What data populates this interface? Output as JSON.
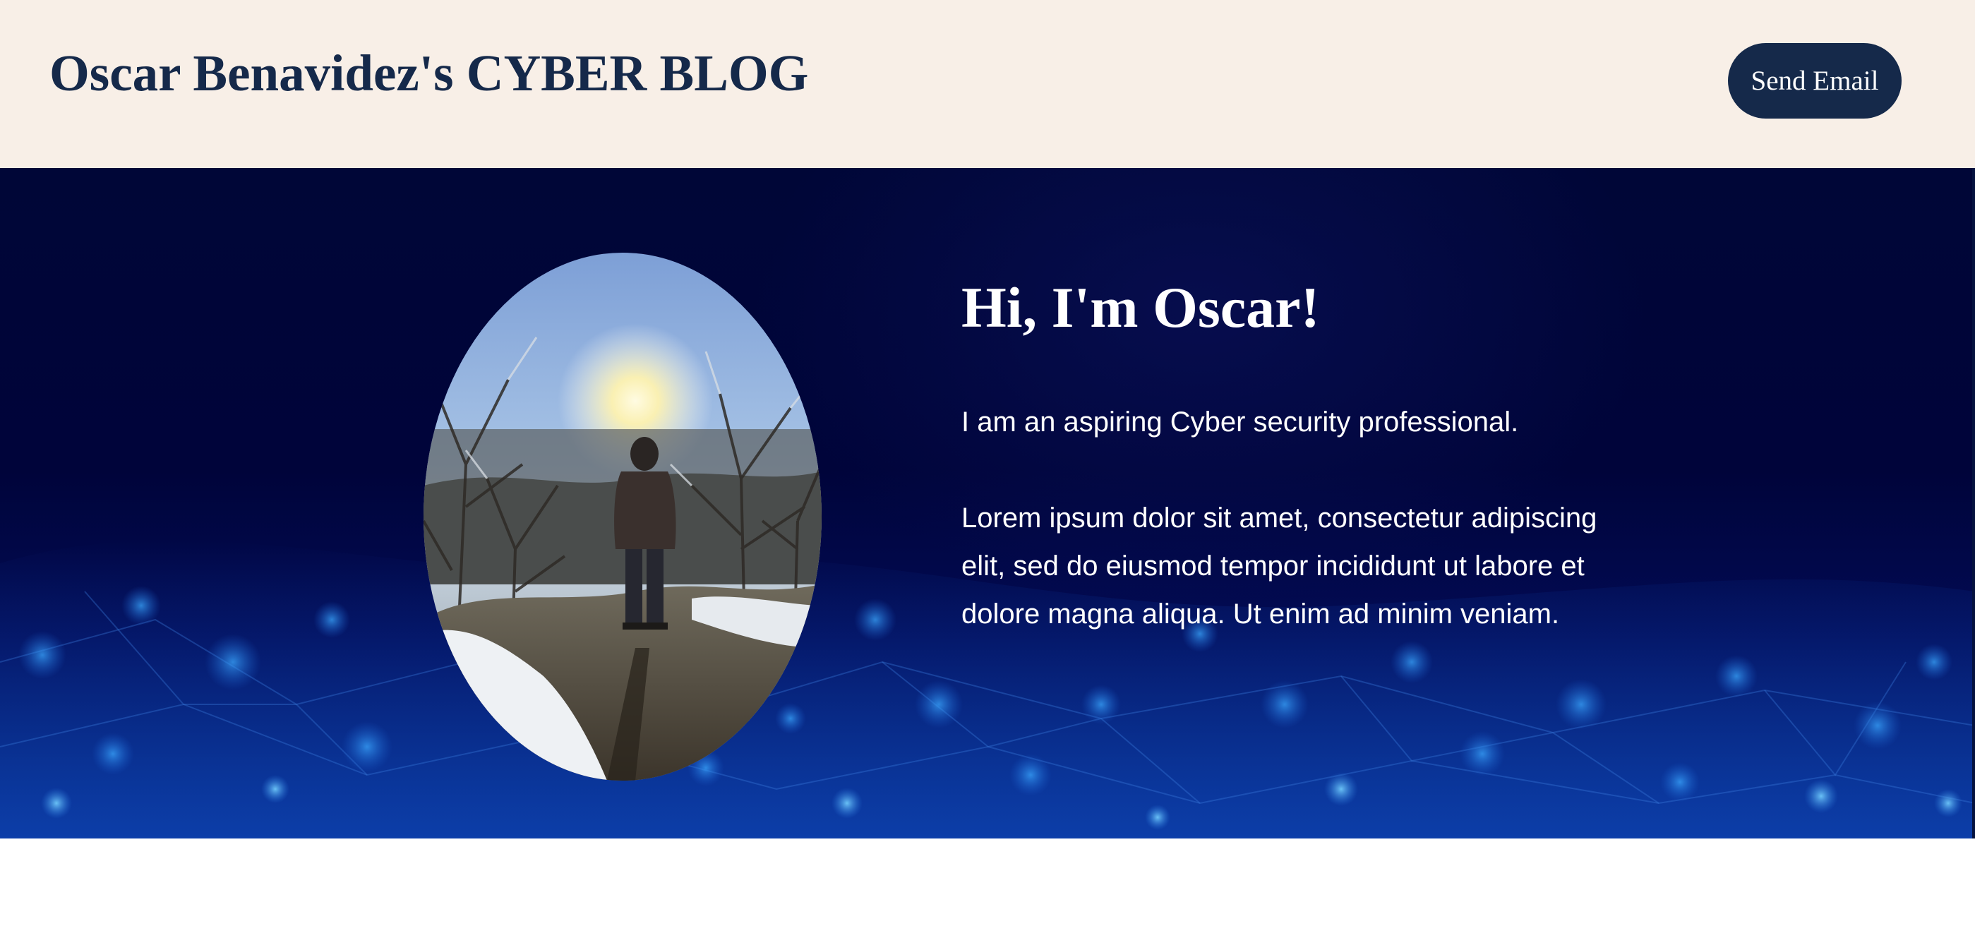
{
  "header": {
    "title": "Oscar Benavidez's CYBER BLOG",
    "send_email_label": "Send Email"
  },
  "hero": {
    "heading": "Hi, I'm Oscar!",
    "tagline": "I am an aspiring Cyber security professional.",
    "body": "Lorem ipsum dolor sit amet, consectetur adipiscing elit, sed do eiusmod tempor incididunt ut labore et dolore magna aliqua. Ut enim ad minim veniam.",
    "portrait_icon": "person-in-snowy-woods-photo"
  },
  "colors": {
    "header_bg": "#f8efe7",
    "brand_navy": "#15294a",
    "hero_bg": "#000637",
    "hero_text": "#ffffff"
  }
}
